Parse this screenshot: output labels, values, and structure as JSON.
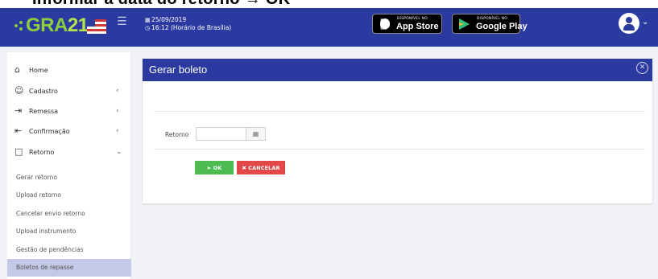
{
  "caption": {
    "text": "Informar a data do retorno → OK"
  },
  "header": {
    "brand_text": "GRA",
    "brand_number": "21",
    "date": "25/09/2019",
    "time": "16:12 (Horário de Brasília)",
    "app_store": {
      "small": "DISPONÍVEL NO",
      "big": "App Store"
    },
    "google_play": {
      "small": "DISPONÍVEL NO",
      "big": "Google Play"
    },
    "brand_green": "#8ccf3c",
    "header_blue": "#2b3aa0"
  },
  "sidebar": {
    "items": [
      {
        "label": "Home",
        "icon": "home-icon"
      },
      {
        "label": "Cadastro",
        "icon": "user-icon"
      },
      {
        "label": "Remessa",
        "icon": "export-icon"
      },
      {
        "label": "Confirmação",
        "icon": "import-icon"
      },
      {
        "label": "Retorno",
        "icon": "tray-icon"
      }
    ],
    "subitems": [
      {
        "label": "Gerar retorno"
      },
      {
        "label": "Upload retorno"
      },
      {
        "label": "Cancelar envio retorno"
      },
      {
        "label": "Upload instrumento"
      },
      {
        "label": "Gestão de pendências"
      },
      {
        "label": "Boletos de repasse",
        "active": true
      }
    ]
  },
  "panel": {
    "title": "Gerar boleto",
    "field_label": "Retorno",
    "input_value": "",
    "ok_label": "OK",
    "cancel_label": "CANCELAR"
  }
}
